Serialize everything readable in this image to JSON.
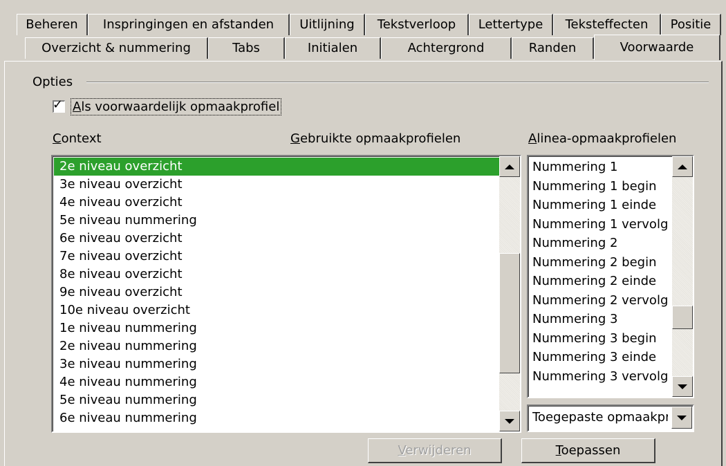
{
  "tabs_row1": [
    "Beheren",
    "Inspringingen en afstanden",
    "Uitlijning",
    "Tekstverloop",
    "Lettertype",
    "Teksteffecten",
    "Positie"
  ],
  "tabs_row2": [
    "Overzicht & nummering",
    "Tabs",
    "Initialen",
    "Achtergrond",
    "Randen",
    "Voorwaarde"
  ],
  "active_tab": "Voorwaarde",
  "options_group": {
    "label": "Opties",
    "checkbox_key": "A",
    "checkbox_rest": "ls voorwaardelijk opmaakprofiel",
    "checked": true
  },
  "columns": {
    "context_key": "C",
    "context_rest": "ontext",
    "applied_key": "G",
    "applied_rest": "ebruikte opmaakprofielen",
    "paragraph_key": "A",
    "paragraph_rest": "linea-opmaakprofielen"
  },
  "context_list": [
    "2e niveau overzicht",
    "3e niveau overzicht",
    "4e niveau overzicht",
    "5e niveau nummering",
    "6e niveau overzicht",
    "7e niveau overzicht",
    "8e niveau overzicht",
    "9e niveau overzicht",
    "10e niveau overzicht",
    "1e niveau nummering",
    "2e niveau nummering",
    "3e niveau nummering",
    "4e niveau nummering",
    "5e niveau nummering",
    "6e niveau nummering"
  ],
  "selected_context": "2e niveau overzicht",
  "paragraph_styles": [
    "Nummering 1",
    "Nummering 1 begin",
    "Nummering 1 einde",
    "Nummering 1 vervolg",
    "Nummering 2",
    "Nummering 2 begin",
    "Nummering 2 einde",
    "Nummering 2 vervolg",
    "Nummering 3",
    "Nummering 3 begin",
    "Nummering 3 einde",
    "Nummering 3 vervolg"
  ],
  "style_filter": {
    "value": "Toegepaste opmaakprofielen"
  },
  "buttons": {
    "remove_key": "V",
    "remove_rest": "erwijderen",
    "apply_key": "T",
    "apply_rest": "oepassen"
  },
  "colors": {
    "selection": "#2ca02c",
    "dialog_bg": "#d4d0c8"
  }
}
